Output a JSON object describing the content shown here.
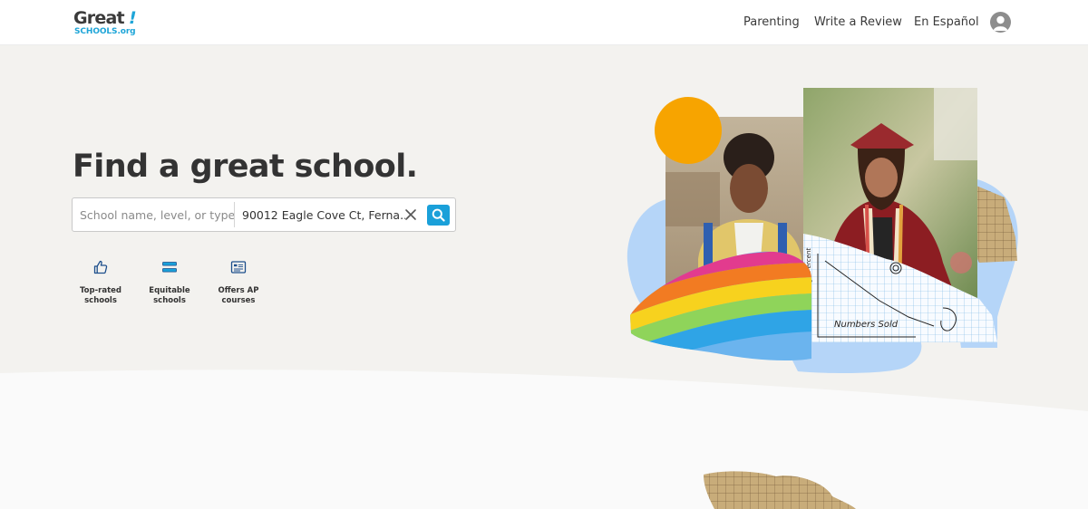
{
  "logo": {
    "text": "Great",
    "mark": "!",
    "sub": "SCHOOLS.org"
  },
  "nav": {
    "items": [
      {
        "label": "Parenting"
      },
      {
        "label": "Write a Review"
      },
      {
        "label": "En Español"
      }
    ],
    "avatar_icon": "user-avatar-icon"
  },
  "hero": {
    "title": "Find a great school.",
    "search": {
      "query_placeholder": "School name, level, or type",
      "query_value": "",
      "location_value": "90012 Eagle Cove Ct, Ferna...",
      "clear_icon": "close-icon",
      "submit_icon": "search-icon",
      "accent": "#1aa0d9"
    },
    "quick_filters": [
      {
        "label_line1": "Top-rated",
        "label_line2": "schools",
        "icon": "thumbs-up-icon"
      },
      {
        "label_line1": "Equitable",
        "label_line2": "schools",
        "icon": "equal-bars-icon"
      },
      {
        "label_line1": "Offers AP",
        "label_line2": "courses",
        "icon": "course-card-icon"
      }
    ],
    "collage": {
      "graph_paper": {
        "y_label": "Average Percent",
        "x_label": "Numbers Sold"
      },
      "colors": {
        "sun": "#f7a400",
        "blob": "#b5d5f8",
        "rainbow": [
          "#e23b8e",
          "#f27b22",
          "#f7d21e",
          "#5bc95b",
          "#2fa4e6",
          "#7b66d6"
        ]
      }
    }
  }
}
